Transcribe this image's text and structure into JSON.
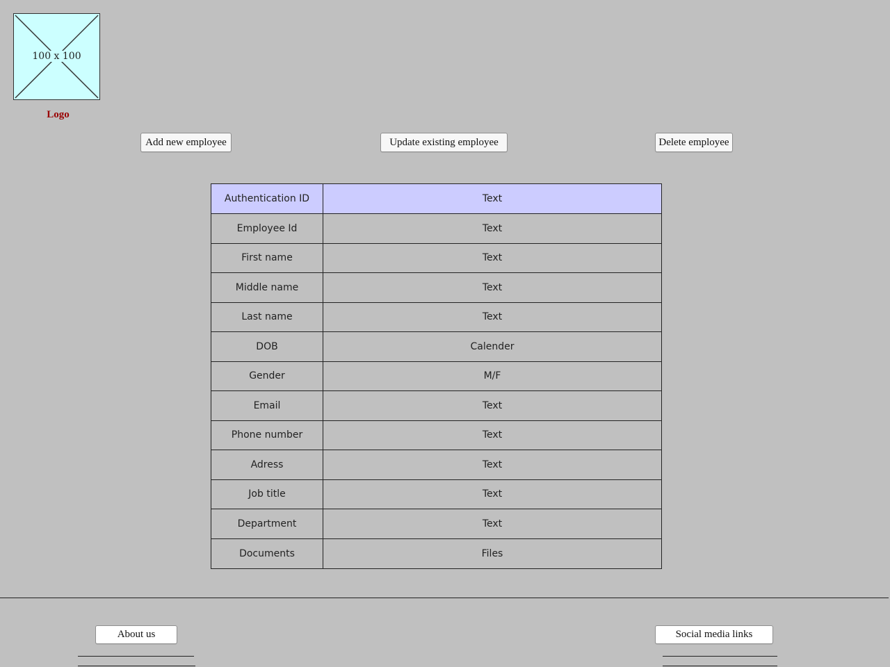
{
  "logo": {
    "placeholder_text": "100 x 100",
    "caption": "Logo"
  },
  "actions": {
    "add_label": "Add new employee",
    "update_label": "Update existing employee",
    "delete_label": "Delete employee"
  },
  "form_table": {
    "rows": [
      {
        "label": "Authentication ID",
        "value": "Text"
      },
      {
        "label": "Employee Id",
        "value": "Text"
      },
      {
        "label": "First name",
        "value": "Text"
      },
      {
        "label": "Middle name",
        "value": "Text"
      },
      {
        "label": "Last name",
        "value": "Text"
      },
      {
        "label": "DOB",
        "value": "Calender"
      },
      {
        "label": "Gender",
        "value": "M/F"
      },
      {
        "label": "Email",
        "value": "Text"
      },
      {
        "label": "Phone number",
        "value": "Text"
      },
      {
        "label": "Adress",
        "value": "Text"
      },
      {
        "label": "Job title",
        "value": "Text"
      },
      {
        "label": "Department",
        "value": "Text"
      },
      {
        "label": "Documents",
        "value": "Files"
      }
    ]
  },
  "footer": {
    "about_label": "About us",
    "social_label": "Social media links"
  },
  "colors": {
    "background": "#c0c0c0",
    "logo_fill": "#ccffff",
    "header_row": "#ccccff",
    "logo_caption": "#990000"
  }
}
